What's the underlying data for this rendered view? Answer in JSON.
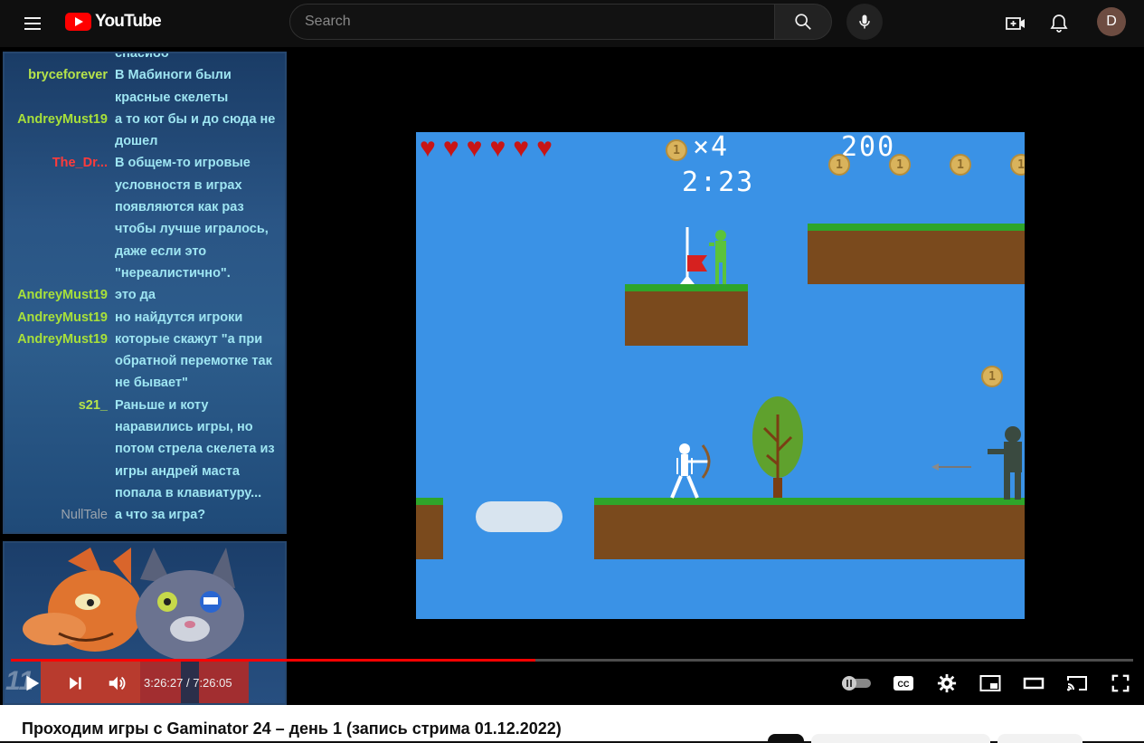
{
  "topbar": {
    "logo_text": "YouTube",
    "search_placeholder": "Search",
    "avatar_letter": "D",
    "icons": [
      "menu-icon",
      "search-icon",
      "mic-icon",
      "create-icon",
      "bell-icon"
    ]
  },
  "chat": {
    "messages": [
      {
        "user": "",
        "text": "спасибо",
        "color": "#9ee5f2"
      },
      {
        "user": "bryceforever",
        "text": "В Мабиноги были красные скелеты",
        "color": "#b6e34a"
      },
      {
        "user": "AndreyMust19",
        "text": "а то кот бы и до сюда не дошел",
        "color": "#a8e03a"
      },
      {
        "user": "The_Dr...",
        "text": "В общем-то игровые условностя в играх появляются как раз чтобы лучше игралось, даже если это \"нереалистично\".",
        "color": "#ff3b3b"
      },
      {
        "user": "AndreyMust19",
        "text": "это да",
        "color": "#a8e03a"
      },
      {
        "user": "AndreyMust19",
        "text": "но найдутся игроки",
        "color": "#a8e03a"
      },
      {
        "user": "AndreyMust19",
        "text": "которые скажут \"а при обратной перемотке так не бывает\"",
        "color": "#a8e03a"
      },
      {
        "user": "s21_",
        "text": "Раньше и коту наравились игры, но потом стрела скелета из игры андрей маста попала в клавиатуру...",
        "color": "#b6e34a"
      },
      {
        "user": "NullTale",
        "text": "а что за игра?",
        "color": "#9aa3ad"
      }
    ]
  },
  "game": {
    "lives": 6,
    "coin_count_label": "×4",
    "score": "200",
    "timer": "2:23",
    "coin_glyph": "1"
  },
  "player": {
    "current_time": "3:26:27",
    "duration": "7:26:05",
    "time_display": "3:26:27 / 7:26:05",
    "progress_fraction": 0.467,
    "overlay_number": "11"
  },
  "video": {
    "title": "Проходим игры с Gaminator 24 – день 1 (запись стрима 01.12.2022)"
  },
  "colors": {
    "accent": "#ff0000",
    "game_sky": "#3a92e6",
    "grass": "#2ea52a",
    "dirt": "#7a4a1d",
    "chat_text": "#9ee5f2"
  }
}
